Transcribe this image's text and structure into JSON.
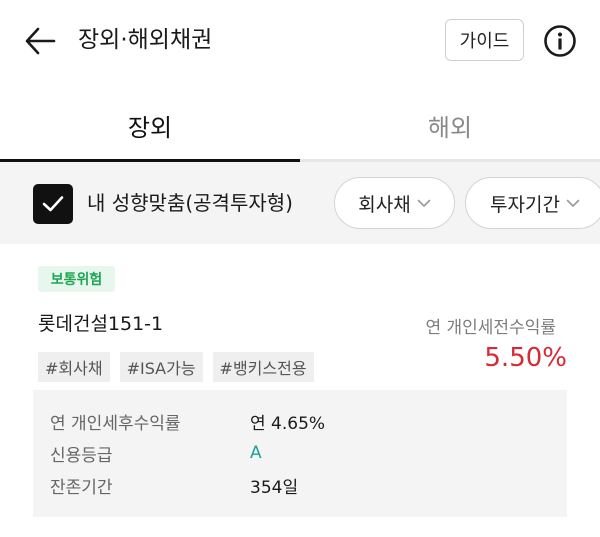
{
  "header": {
    "title": "장외·해외채권",
    "guide_label": "가이드"
  },
  "tabs": [
    {
      "label": "장외",
      "active": true
    },
    {
      "label": "해외",
      "active": false
    }
  ],
  "filters": {
    "my_profile_checked": true,
    "my_profile_label": "내 성향맞춤(공격투자형)",
    "chip_bond_type": "회사채",
    "chip_term": "투자기간"
  },
  "bond": {
    "risk_badge": "보통위험",
    "name": "롯데건설151-1",
    "yield_label": "연 개인세전수익률",
    "yield_value": "5.50%",
    "tags": [
      "#회사채",
      "#ISA가능",
      "#뱅키스전용"
    ],
    "details": [
      {
        "key": "연 개인세후수익률",
        "value": "연 4.65%"
      },
      {
        "key": "신용등급",
        "value": "A"
      },
      {
        "key": "잔존기간",
        "value": "354일"
      }
    ]
  },
  "colors": {
    "accent_red": "#d62b35",
    "risk_green": "#1fa653",
    "grade_teal": "#1aa29a"
  }
}
